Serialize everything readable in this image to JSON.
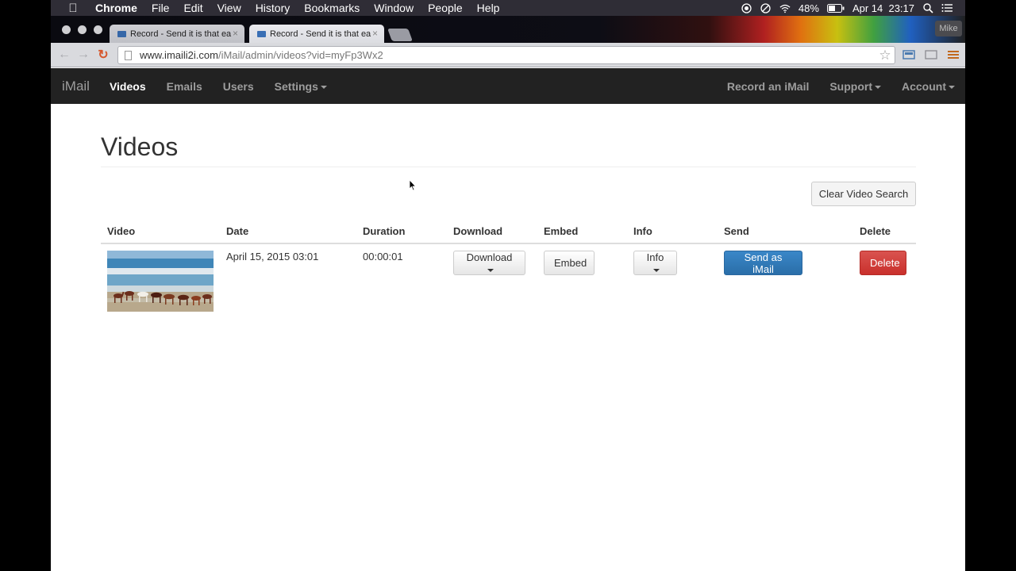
{
  "menubar": {
    "app": "Chrome",
    "items": [
      "File",
      "Edit",
      "View",
      "History",
      "Bookmarks",
      "Window",
      "People",
      "Help"
    ],
    "battery": "48%",
    "datetime": "Apr 14  23:17"
  },
  "browser": {
    "tabs": [
      {
        "label": "Record - Send it is that ea"
      },
      {
        "label": "Record - Send it is that ea"
      }
    ],
    "profile": "Mike",
    "url_domain": "www.imaili2i.com",
    "url_path": "/iMail/admin/videos?vid=myFp3Wx2"
  },
  "appnav": {
    "brand": "iMail",
    "left": [
      "Videos",
      "Emails",
      "Users",
      "Settings"
    ],
    "right": [
      "Record an iMail",
      "Support",
      "Account"
    ]
  },
  "page": {
    "title": "Videos",
    "clear_button": "Clear Video Search"
  },
  "table": {
    "headers": [
      "Video",
      "Date",
      "Duration",
      "Download",
      "Embed",
      "Info",
      "Send",
      "Delete"
    ],
    "rows": [
      {
        "date": "April 15, 2015 03:01",
        "duration": "00:00:01",
        "download_btn": "Download",
        "embed_btn": "Embed",
        "info_btn": "Info",
        "send_btn": "Send as iMail",
        "delete_btn": "Delete"
      }
    ]
  },
  "colors": {
    "primary": "#337ab7",
    "danger": "#d9534f",
    "navbar": "#222222"
  }
}
